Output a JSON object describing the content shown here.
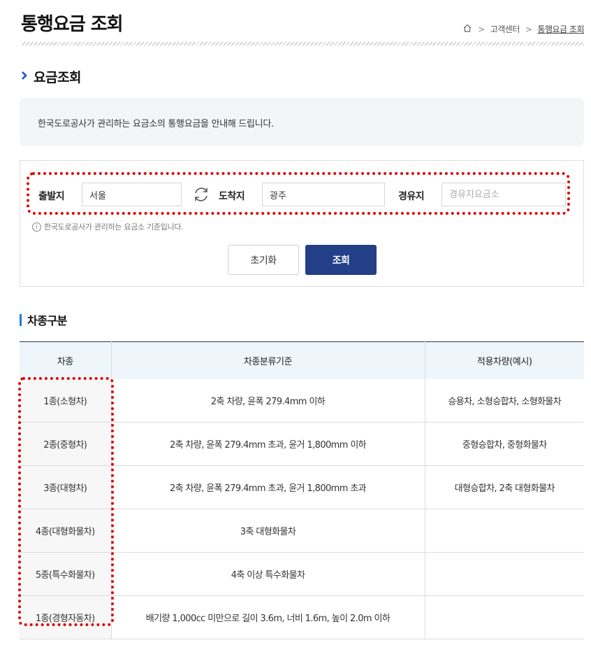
{
  "header": {
    "title": "통행요금 조회",
    "breadcrumb": [
      "고객센터",
      "통행요금 조회"
    ]
  },
  "section": {
    "title": "요금조회",
    "info_text": "한국도로공사가 관리하는 요금소의 통행요금을 안내해 드립니다."
  },
  "search": {
    "origin_label": "출발지",
    "origin_value": "서울",
    "destination_label": "도착지",
    "destination_value": "광주",
    "waypoint_label": "경유지",
    "waypoint_placeholder": "경유지요금소",
    "note": "한국도로공사가 관리하는 요금소 기준입니다.",
    "reset_label": "초기화",
    "search_label": "조회"
  },
  "vehicle": {
    "title": "차종구분",
    "headers": [
      "차종",
      "차종분류기준",
      "적용차량(예시)"
    ],
    "rows": [
      {
        "type": "1종(소형차)",
        "criteria": "2축 차량, 윤폭 279.4mm 이하",
        "example": "승용차, 소형승합차, 소형화물차"
      },
      {
        "type": "2종(중형차)",
        "criteria": "2축 차량, 윤폭 279.4mm 초과, 윤거 1,800mm 이하",
        "example": "중형승합차, 중형화물차"
      },
      {
        "type": "3종(대형차)",
        "criteria": "2축 차량, 윤폭 279.4mm 초과, 윤거 1,800mm 초과",
        "example": "대형승합차, 2축 대형화물차"
      },
      {
        "type": "4종(대형화물차)",
        "criteria": "3축 대형화물차",
        "example": ""
      },
      {
        "type": "5종(특수화물차)",
        "criteria": "4축 이상 특수화물차",
        "example": ""
      },
      {
        "type": "1종(경형자동차)",
        "criteria": "배기량 1,000cc 미만으로 길이 3.6m, 너비 1.6m, 높이 2.0m 이하",
        "example": ""
      }
    ]
  },
  "colors": {
    "accent_blue": "#233f87",
    "highlight_red": "#e00000",
    "section_bar": "#1d7bd8"
  }
}
